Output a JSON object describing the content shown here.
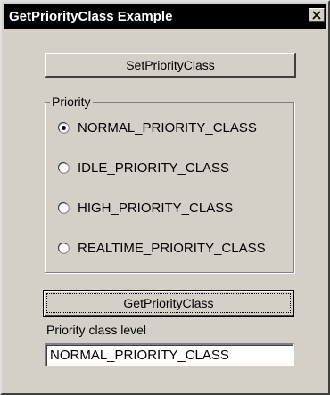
{
  "window": {
    "title": "GetPriorityClass Example",
    "colors": {
      "face": "#d4d0c8",
      "titlebar": "#000000",
      "title_text": "#ffffff",
      "field_bg": "#ffffff"
    }
  },
  "titlebar": {
    "close_icon": "close-x-icon"
  },
  "set_button": {
    "label": "SetPriorityClass"
  },
  "priority_group": {
    "legend": "Priority",
    "options": [
      {
        "label": "NORMAL_PRIORITY_CLASS",
        "selected": true
      },
      {
        "label": "IDLE_PRIORITY_CLASS",
        "selected": false
      },
      {
        "label": "HIGH_PRIORITY_CLASS",
        "selected": false
      },
      {
        "label": "REALTIME_PRIORITY_CLASS",
        "selected": false
      }
    ]
  },
  "get_button": {
    "label": "GetPriorityClass"
  },
  "result": {
    "label": "Priority class level",
    "value": "NORMAL_PRIORITY_CLASS"
  }
}
